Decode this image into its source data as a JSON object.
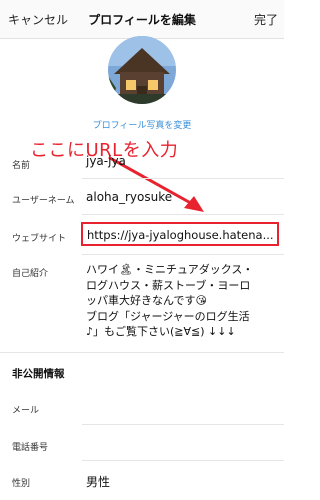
{
  "header": {
    "cancel": "キャンセル",
    "title": "プロフィールを編集",
    "done": "完了"
  },
  "profile_photo": {
    "change_label": "プロフィール写真を変更"
  },
  "annotation": {
    "text": "ここにURLを入力"
  },
  "fields": {
    "name": {
      "label": "名前",
      "value": "jya-jya"
    },
    "username": {
      "label": "ユーザーネーム",
      "value": "aloha_ryosuke"
    },
    "website": {
      "label": "ウェブサイト",
      "value": "https://jya-jyaloghouse.hatena..."
    },
    "bio": {
      "label": "自己紹介",
      "lines": [
        "ハワイ🏝・ミニチュアダックス・",
        "ログハウス・薪ストーブ・ヨーロ",
        "ッパ車大好きなんです😘",
        "ブログ「ジャージャーのログ生活",
        "♪」もご覧下さい(≧∀≦) ↓↓↓"
      ]
    }
  },
  "private_info": {
    "section_title": "非公開情報",
    "email": {
      "label": "メール",
      "value": ""
    },
    "phone": {
      "label": "電話番号",
      "value": ""
    },
    "gender": {
      "label": "性別",
      "value": "男性"
    }
  },
  "colors": {
    "accent_red": "#e8232f",
    "link_blue": "#3a8fd8"
  }
}
